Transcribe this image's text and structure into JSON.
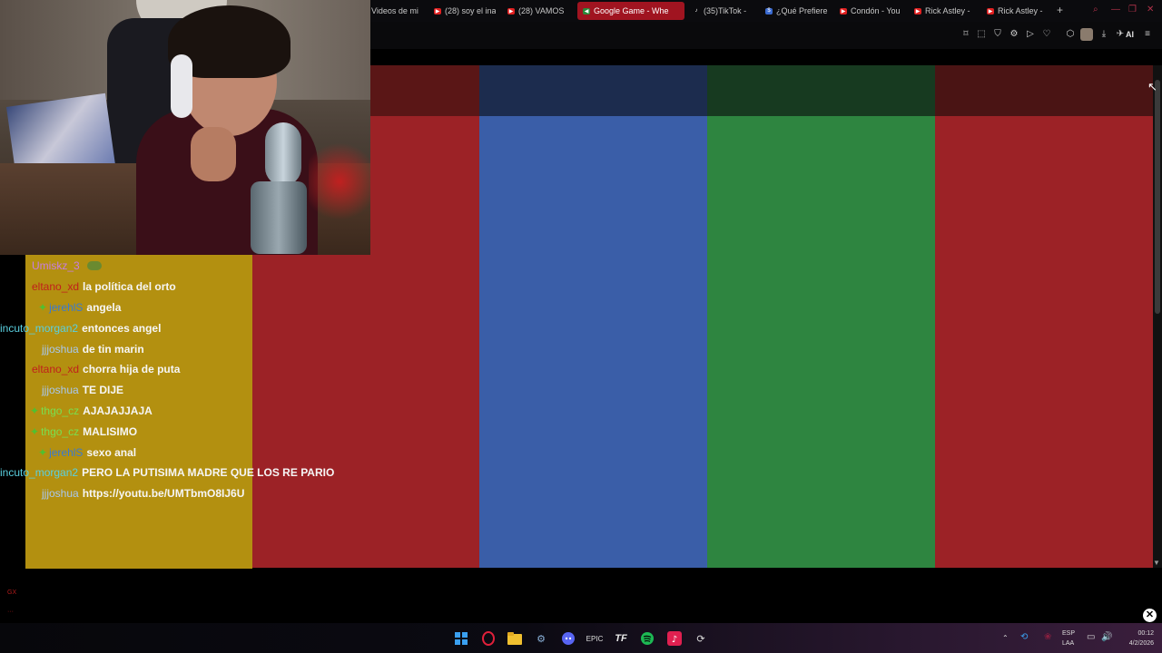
{
  "browser": {
    "tabs": [
      {
        "label": "Videos de mi",
        "icon": "folder-icon",
        "active": false
      },
      {
        "label": "(28) soy el ina",
        "icon": "youtube-icon",
        "active": false
      },
      {
        "label": "(28) VAMOS",
        "icon": "youtube-icon",
        "active": false
      },
      {
        "label": "Google Game - Whe",
        "icon": "speaker-icon",
        "active": true
      },
      {
        "label": "(35)TikTok -",
        "icon": "tiktok-icon",
        "active": false
      },
      {
        "label": "¿Qué Prefiere",
        "icon": "dollar-icon",
        "active": false
      },
      {
        "label": "Condón - You",
        "icon": "youtube-icon",
        "active": false
      },
      {
        "label": "Rick Astley -",
        "icon": "youtube-icon",
        "active": false
      },
      {
        "label": "Rick Astley -",
        "icon": "youtube-icon",
        "active": false
      }
    ],
    "new_tab": "+",
    "toolbar_ai": "AI"
  },
  "game": {
    "colors": {
      "red": "#9c2226",
      "blue": "#3a5ea8",
      "green": "#2e8540",
      "red_dark": "#5a1616",
      "blue_dark": "#1c2c4e",
      "green_dark": "#173a20"
    }
  },
  "chat": {
    "background": "#b39010",
    "lines": [
      {
        "user": "Umiskz_3",
        "user_color": "#c77ee0",
        "message": "",
        "badge": false,
        "emote": "frog-emote"
      },
      {
        "user": "eltano_xd",
        "user_color": "#c0201c",
        "message": "la política del orto",
        "badge": false
      },
      {
        "user": "jerehlS",
        "user_color": "#3a7ad0",
        "message": "angela",
        "badge": true
      },
      {
        "user": "incuto_morgan2",
        "user_color": "#5ad0e0",
        "message": "entonces angel",
        "badge": false
      },
      {
        "user": "jjjoshua",
        "user_color": "#a8c8f0",
        "message": "de tin marin",
        "badge": false
      },
      {
        "user": "eltano_xd",
        "user_color": "#c0201c",
        "message": "chorra hija de puta",
        "badge": false
      },
      {
        "user": "jjjoshua",
        "user_color": "#a8c8f0",
        "message": "TE DIJE",
        "badge": false
      },
      {
        "user": "thgo_cz",
        "user_color": "#78e050",
        "message": "AJAJAJJAJA",
        "badge": true
      },
      {
        "user": "thgo_cz",
        "user_color": "#78e050",
        "message": "MALISIMO",
        "badge": true
      },
      {
        "user": "jerehlS",
        "user_color": "#3a7ad0",
        "message": "sexo anal",
        "badge": true
      },
      {
        "user": "incuto_morgan2",
        "user_color": "#5ad0e0",
        "message": "PERO LA PUTISIMA MADRE QUE LOS RE PARIO",
        "badge": false
      },
      {
        "user": "jjjoshua",
        "user_color": "#a8c8f0",
        "message": "https://youtu.be/UMTbmO8IJ6U",
        "badge": false
      }
    ]
  },
  "taskbar": {
    "apps": [
      "windows-start-icon",
      "opera-gx-icon",
      "file-explorer-icon",
      "steam-icon",
      "discord-icon",
      "epic-games-icon",
      "tf-icon",
      "spotify-icon",
      "tiktok-live-icon",
      "update-icon"
    ],
    "lang_line1": "ESP",
    "lang_line2": "LAA",
    "time": "00:12",
    "date": "4/2/2026"
  },
  "overlay": {
    "mark_top": "GX",
    "mark_bottom": "···"
  }
}
